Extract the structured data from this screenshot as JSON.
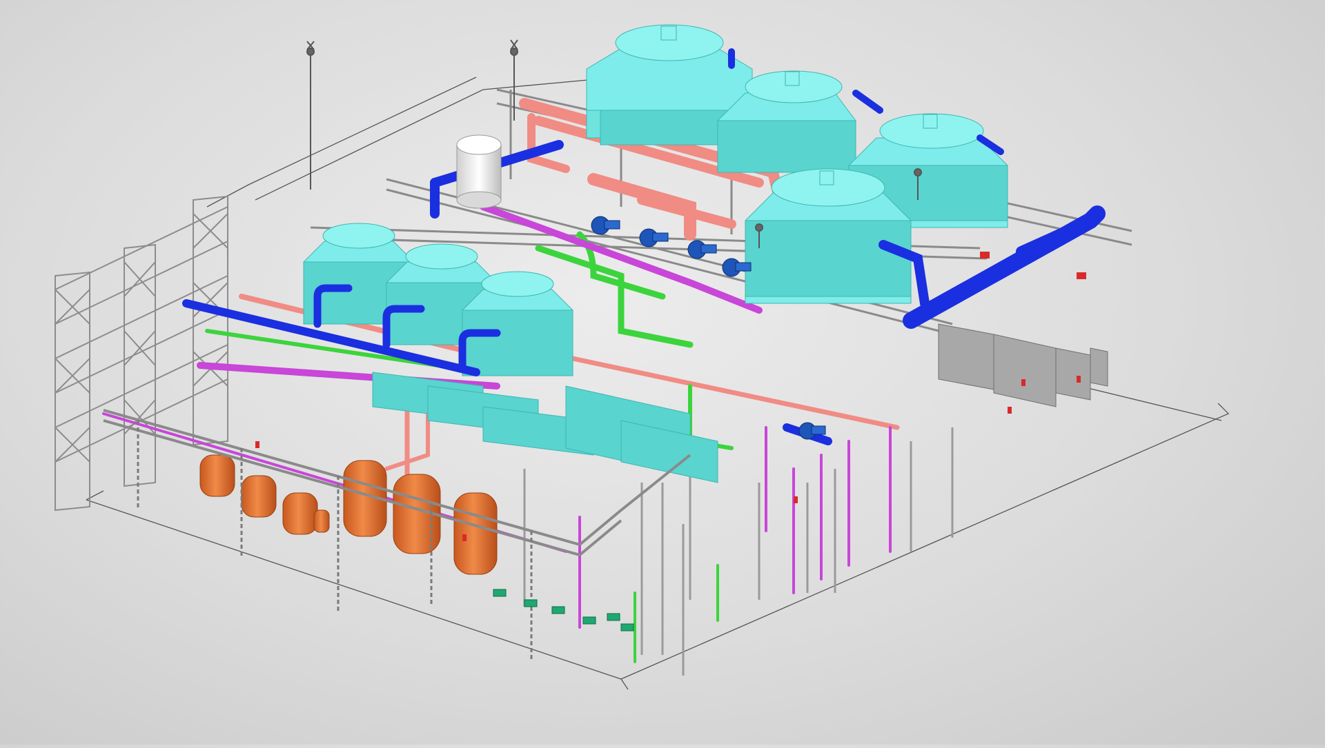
{
  "scene": {
    "view": "isometric",
    "background": "#dcdcdc",
    "colors": {
      "cooling_tower": "#6fe3de",
      "cooling_tower_dark": "#3fb6b2",
      "chilled_water_pipe": "#1a2fe0",
      "condenser_pipe": "#f08c84",
      "glycol_pipe": "#3cd43c",
      "process_pipe": "#c846d8",
      "pressure_vessel": "#e8743a",
      "steel_frame": "#9a9a9a",
      "pump": "#1d55b8",
      "expansion_tank": "#f2f2f2",
      "electrical_panel": "#a8a8a8"
    },
    "equipment": {
      "large_cooling_towers": 4,
      "small_cooling_towers": 3,
      "filter_vessels": 7,
      "circulation_pumps": 5,
      "lightning_rods": 4
    }
  }
}
